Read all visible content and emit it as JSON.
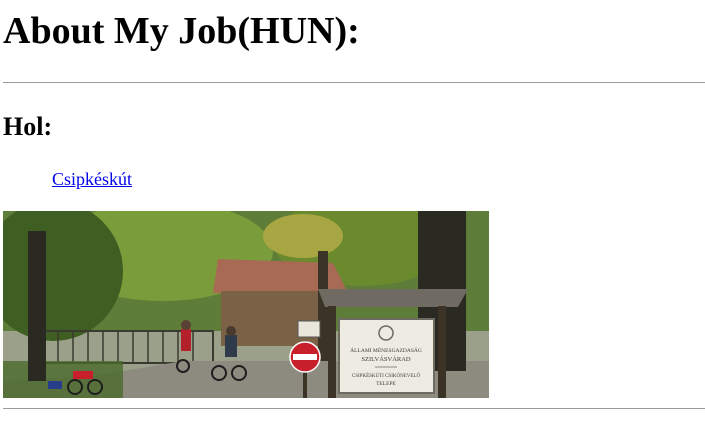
{
  "page": {
    "title": "About My Job(HUN):",
    "section_heading": "Hol:",
    "location_link": "Csipkéskút"
  },
  "photo": {
    "sign_lines": [
      "ÁLLAMI MÉNESGAZDASÁG",
      "SZILVÁSVÁRAD",
      "CSIPKÉSKÚTI CSIKÓNEVELŐ",
      "TELEPE"
    ],
    "colors": {
      "foliage": "#4f7a2a",
      "bark": "#2b2a22",
      "road": "#8d8a80",
      "roof": "#a86a55",
      "sign_board": "#eeece2",
      "stop_sign": "#c7202a"
    }
  }
}
